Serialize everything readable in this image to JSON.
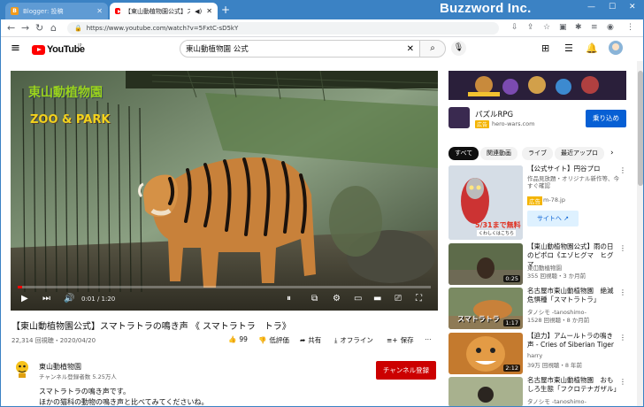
{
  "browser": {
    "tabs": [
      {
        "title": "Blogger: 投稿",
        "icon": "blogger-icon",
        "active": false
      },
      {
        "title": "【東山動植物園公式】スマトラトラ",
        "icon": "youtube-icon",
        "active": true
      }
    ],
    "brand": "Buzzword Inc.",
    "url": "https://www.youtube.com/watch?v=5FxtC-sD5kY"
  },
  "youtube": {
    "logo_text": "YouTube",
    "logo_region": "JP",
    "search_value": "東山動植物園 公式",
    "colors": {
      "brand_red": "#ff0000",
      "subscribe_red": "#cc0000",
      "ad_blue": "#065fd4"
    }
  },
  "player": {
    "watermark_line1": "東山動植物園",
    "watermark_line2": "ZOO & PARK",
    "time": "0:01 / 1:20",
    "progress_fraction": 0.01
  },
  "video": {
    "title": "【東山動植物園公式】スマトラトラの鳴き声 《 スマトラトラ　トラ》",
    "meta": "22,314 回視聴・2020/04/20",
    "likes": "99",
    "dislike_label": "低評価",
    "share_label": "共有",
    "offline_label": "オフライン",
    "save_label": "保存"
  },
  "channel": {
    "name": "東山動植物園",
    "subs": "チャンネル登録者数 5.25万人",
    "subscribe_label": "チャンネル登録",
    "description": [
      "スマトラトラの鳴き声です。",
      "ほかの猫科の動物の鳴き声と比べてみてくださいね。"
    ]
  },
  "sidebar": {
    "ad": {
      "title": "パズルRPG",
      "badge": "広告",
      "domain": "hero-wars.com",
      "button": "乗り込め"
    },
    "chips": [
      "すべて",
      "関連動画",
      "ライブ",
      "最近アップロ"
    ],
    "items": [
      {
        "title": "【公式サイト】円谷プロ",
        "sub1": "作品見放題・オリジナル新作等、今すぐ確認",
        "badge": "広告",
        "sub2": "m-78.jp",
        "button": "サイトへ",
        "thumb_caption": "5/31まで無料",
        "thumb_caption2": "くわしくはこちら"
      },
      {
        "title": "【東山動植物園公式】雨の日のピポロ《エゾヒグマ　ヒグマ…",
        "sub1": "東山動植物園",
        "sub2": "355 回視聴・3 か月前",
        "duration": "0:25"
      },
      {
        "title": "名古屋市東山動植物園　絶滅危惧種「スマトラトラ」",
        "sub1": "タノシモ -tanoshimo-",
        "sub2": "1528 回視聴・8 か月前",
        "duration": "1:17",
        "thumb_caption": "スマトラトラ"
      },
      {
        "title": "【迫力】アムールトラの鳴き声 - Cries of Siberian Tiger",
        "sub1": "harry",
        "sub2": "39万 回視聴・8 年前",
        "duration": "2:12"
      },
      {
        "title": "名古屋市東山動植物園　おもしろ生態「フクロテナガザル」",
        "sub1": "タノシモ -tanoshimo-",
        "sub2": "",
        "duration": ""
      }
    ]
  }
}
